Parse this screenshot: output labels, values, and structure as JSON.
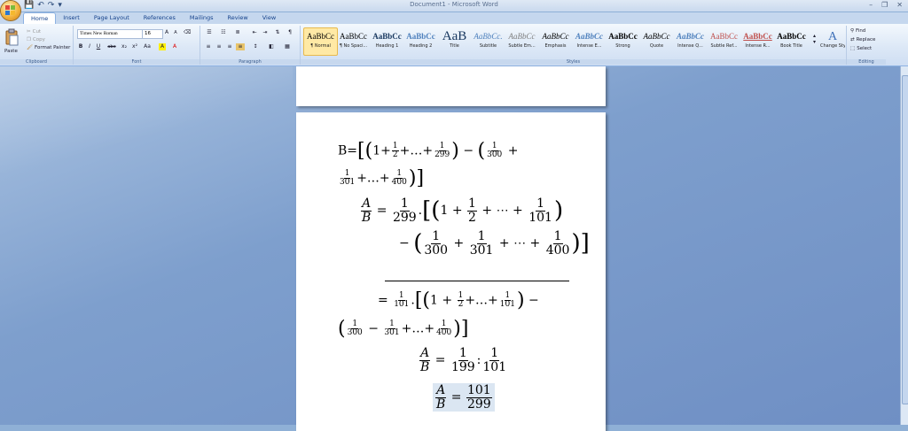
{
  "window": {
    "title": "Document1 - Microsoft Word",
    "controls": [
      "–",
      "❐",
      "✕"
    ]
  },
  "quick_access": [
    "💾",
    "↶",
    "↷",
    "▾"
  ],
  "tabs": [
    "Home",
    "Insert",
    "Page Layout",
    "References",
    "Mailings",
    "Review",
    "View"
  ],
  "ribbon": {
    "clipboard": {
      "paste": "Paste",
      "cut": "Cut",
      "copy": "Copy",
      "format_painter": "Format Painter",
      "label": "Clipboard"
    },
    "font": {
      "name": "Times New Roman",
      "size": "16",
      "label": "Font",
      "buttons": [
        "B",
        "I",
        "U",
        "abe",
        "x₂",
        "x²",
        "Aa",
        "A",
        "A"
      ],
      "grow": "A",
      "shrink": "A"
    },
    "paragraph": {
      "label": "Paragraph"
    },
    "styles": {
      "label": "Styles",
      "items": [
        {
          "sample": "AaBbCc",
          "name": "¶ Normal"
        },
        {
          "sample": "AaBbCc",
          "name": "¶ No Spaci..."
        },
        {
          "sample": "AaBbCc",
          "name": "Heading 1"
        },
        {
          "sample": "AaBbCc",
          "name": "Heading 2"
        },
        {
          "sample": "AaB",
          "name": "Title"
        },
        {
          "sample": "AaBbCc.",
          "name": "Subtitle"
        },
        {
          "sample": "AaBbCc",
          "name": "Subtle Em..."
        },
        {
          "sample": "AaBbCc",
          "name": "Emphasis"
        },
        {
          "sample": "AaBbCc",
          "name": "Intense E..."
        },
        {
          "sample": "AaBbCc",
          "name": "Strong"
        },
        {
          "sample": "AaBbCc",
          "name": "Quote"
        },
        {
          "sample": "AaBbCc",
          "name": "Intense Q..."
        },
        {
          "sample": "AaBbCc",
          "name": "Subtle Ref..."
        },
        {
          "sample": "AaBbCc",
          "name": "Intense R..."
        },
        {
          "sample": "AaBbCc",
          "name": "Book Title"
        }
      ],
      "change_styles": "Change Styles"
    },
    "editing": {
      "label": "Editing",
      "find": "Find",
      "replace": "Replace",
      "select": "Select"
    }
  },
  "document": {
    "line1_prefix": "B=",
    "one": "1",
    "plus": "+",
    "ellipsis": "…",
    "minus": "−",
    "cdots": "⋯",
    "n2": "2",
    "n299": "299",
    "n300": "300",
    "n301": "301",
    "n400": "400",
    "n101": "101",
    "n199": "199",
    "A": "A",
    "B": "B",
    "eq": "=",
    "dot": ".",
    "colon": ":",
    "comma": ""
  }
}
